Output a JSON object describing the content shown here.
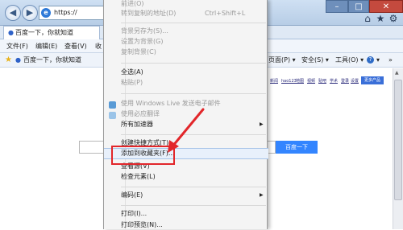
{
  "address": {
    "url_text": "https://"
  },
  "tab": {
    "title": "百度一下，你就知道"
  },
  "menubar": {
    "items": [
      "文件(F)",
      "编辑(E)",
      "查看(V)",
      "收"
    ]
  },
  "favorites_bar": {
    "item": "百度一下，你就知道",
    "cmd_items": [
      "页面(P) ▾",
      "安全(S) ▾",
      "工具(O) ▾",
      "▾"
    ]
  },
  "context_menu": {
    "items": [
      {
        "label": "前进(O)",
        "shortcut": "",
        "disabled": true
      },
      {
        "label": "转到复制的地址(D)",
        "shortcut": "Ctrl+Shift+L",
        "disabled": true
      },
      {
        "label": "背景另存为(S)...",
        "shortcut": "",
        "disabled": true
      },
      {
        "label": "设置为背景(G)",
        "shortcut": "",
        "disabled": true
      },
      {
        "label": "复制背景(C)",
        "shortcut": "",
        "disabled": true
      },
      {
        "label": "全选(A)",
        "shortcut": "",
        "disabled": false
      },
      {
        "label": "粘贴(P)",
        "shortcut": "",
        "disabled": true
      },
      {
        "label": "使用 Windows Live 发送电子邮件",
        "shortcut": "",
        "disabled": true
      },
      {
        "label": "使用必应翻译",
        "shortcut": "",
        "disabled": true
      },
      {
        "label": "所有加速器",
        "shortcut": "",
        "disabled": false
      },
      {
        "label": "创建快捷方式(T)",
        "shortcut": "",
        "disabled": false
      },
      {
        "label": "添加到收藏夹(F)...",
        "shortcut": "",
        "disabled": false
      },
      {
        "label": "查看源(V)",
        "shortcut": "",
        "disabled": false
      },
      {
        "label": "检查元素(L)",
        "shortcut": "",
        "disabled": false
      },
      {
        "label": "编码(E)",
        "shortcut": "",
        "disabled": false
      },
      {
        "label": "打印(I)...",
        "shortcut": "",
        "disabled": false
      },
      {
        "label": "打印预览(N)...",
        "shortcut": "",
        "disabled": false
      }
    ]
  },
  "page": {
    "top_links": [
      "新闻",
      "hao123",
      "地图",
      "视频",
      "贴吧",
      "学术",
      "登录",
      "设置"
    ],
    "more_products": "更多产品",
    "search_button": "百度一下"
  },
  "colors": {
    "highlight_box": "#e2262a",
    "baidu_blue": "#3385ff"
  }
}
